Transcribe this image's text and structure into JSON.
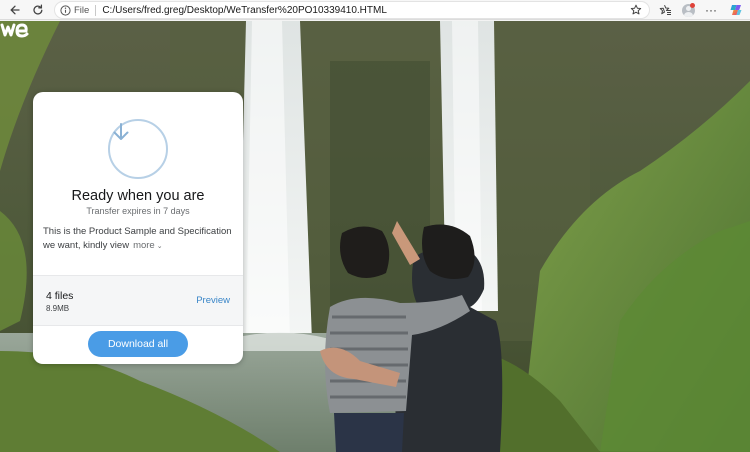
{
  "browser": {
    "address_scheme": "File",
    "url": "C:/Users/fred.greg/Desktop/WeTransfer%20PO10339410.HTML",
    "more_label": "···",
    "icons": [
      "back-icon",
      "refresh-icon",
      "info-icon",
      "star-icon",
      "favorites-icon",
      "profile-avatar",
      "more-icon",
      "copilot-icon"
    ]
  },
  "page": {
    "logo_icon": "wetransfer-logo",
    "card": {
      "icon": "download-arrow-icon",
      "title": "Ready when you are",
      "subtitle": "Transfer expires in 7 days",
      "message": "This is the Product Sample and Specification we want, kindly view",
      "more_label": "more",
      "files_count": "4 files",
      "files_size": "8.9MB",
      "preview_label": "Preview",
      "download_label": "Download all",
      "accent_color": "#4a9ce6"
    }
  }
}
